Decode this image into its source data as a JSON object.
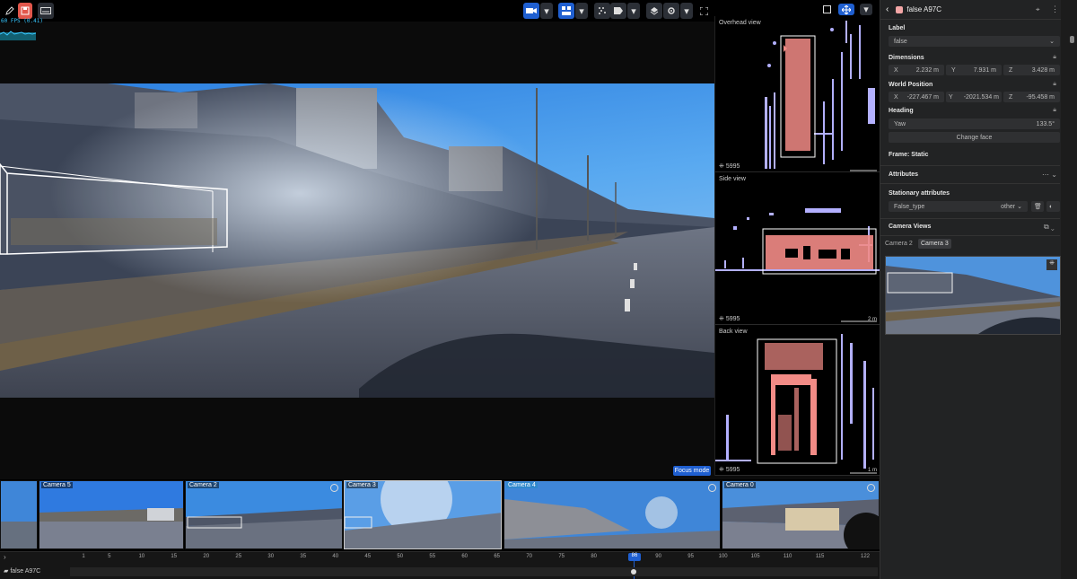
{
  "toolbar": {
    "icons": [
      "edit-icon",
      "save-icon",
      "keyboard-icon",
      "camera-icon",
      "layout-icon",
      "lidar-icon",
      "label-icon",
      "layers-icon",
      "settings-icon",
      "fullscreen-icon",
      "square-icon",
      "move-icon"
    ],
    "fps_text": "60 FPS (0.41)"
  },
  "main_view": {
    "focus_mode_label": "Focus mode"
  },
  "views": {
    "overhead": {
      "title": "Overhead view",
      "count": "5995"
    },
    "side": {
      "title": "Side view",
      "count": "5995",
      "scale": "2 m"
    },
    "back": {
      "title": "Back view",
      "count": "5995",
      "scale": "1 m"
    }
  },
  "panel": {
    "title": "false A97C",
    "label_heading": "Label",
    "label_value": "false",
    "dimensions_heading": "Dimensions",
    "dimensions": {
      "x_label": "X",
      "x": "2.232 m",
      "y_label": "Y",
      "y": "7.931 m",
      "z_label": "Z",
      "z": "3.428 m"
    },
    "world_heading": "World Position",
    "world": {
      "x_label": "X",
      "x": "-227.467 m",
      "y_label": "Y",
      "y": "-2021.534 m",
      "z_label": "Z",
      "z": "-95.458 m"
    },
    "heading_heading": "Heading",
    "yaw_label": "Yaw",
    "yaw_value": "133.5°",
    "change_face": "Change face",
    "frame": "Frame: Static",
    "attributes_heading": "Attributes",
    "stationary_heading": "Stationary attributes",
    "false_type_label": "False_type",
    "false_type_value": "other",
    "camera_views_heading": "Camera Views",
    "camera_tabs": [
      "Camera 2",
      "Camera 3"
    ],
    "accent": "#f3a6a6"
  },
  "strip": {
    "cameras": [
      "Camera 5",
      "Camera 2",
      "Camera 3",
      "Camera 4",
      "Camera 0"
    ]
  },
  "timeline": {
    "ticks": [
      "1",
      "5",
      "10",
      "15",
      "20",
      "25",
      "30",
      "35",
      "40",
      "45",
      "50",
      "55",
      "60",
      "65",
      "70",
      "75",
      "80",
      "86",
      "90",
      "95",
      "100",
      "105",
      "110",
      "115",
      "122"
    ],
    "current_frame": "86",
    "track_label": "false A97C"
  }
}
